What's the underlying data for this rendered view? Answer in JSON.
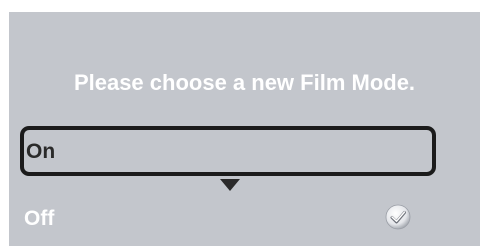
{
  "dialog": {
    "prompt": "Please choose a new Film Mode.",
    "options": [
      {
        "label": "On",
        "highlighted": true,
        "selected": false
      },
      {
        "label": "Off",
        "highlighted": false,
        "selected": true
      }
    ],
    "selected_indicator_icon": "check-icon",
    "scroll_indicator_icon": "down-arrow-icon"
  },
  "colors": {
    "background": "#c3c6cc",
    "text_primary": "#ffffff",
    "highlight_border": "#1b1b1b"
  }
}
